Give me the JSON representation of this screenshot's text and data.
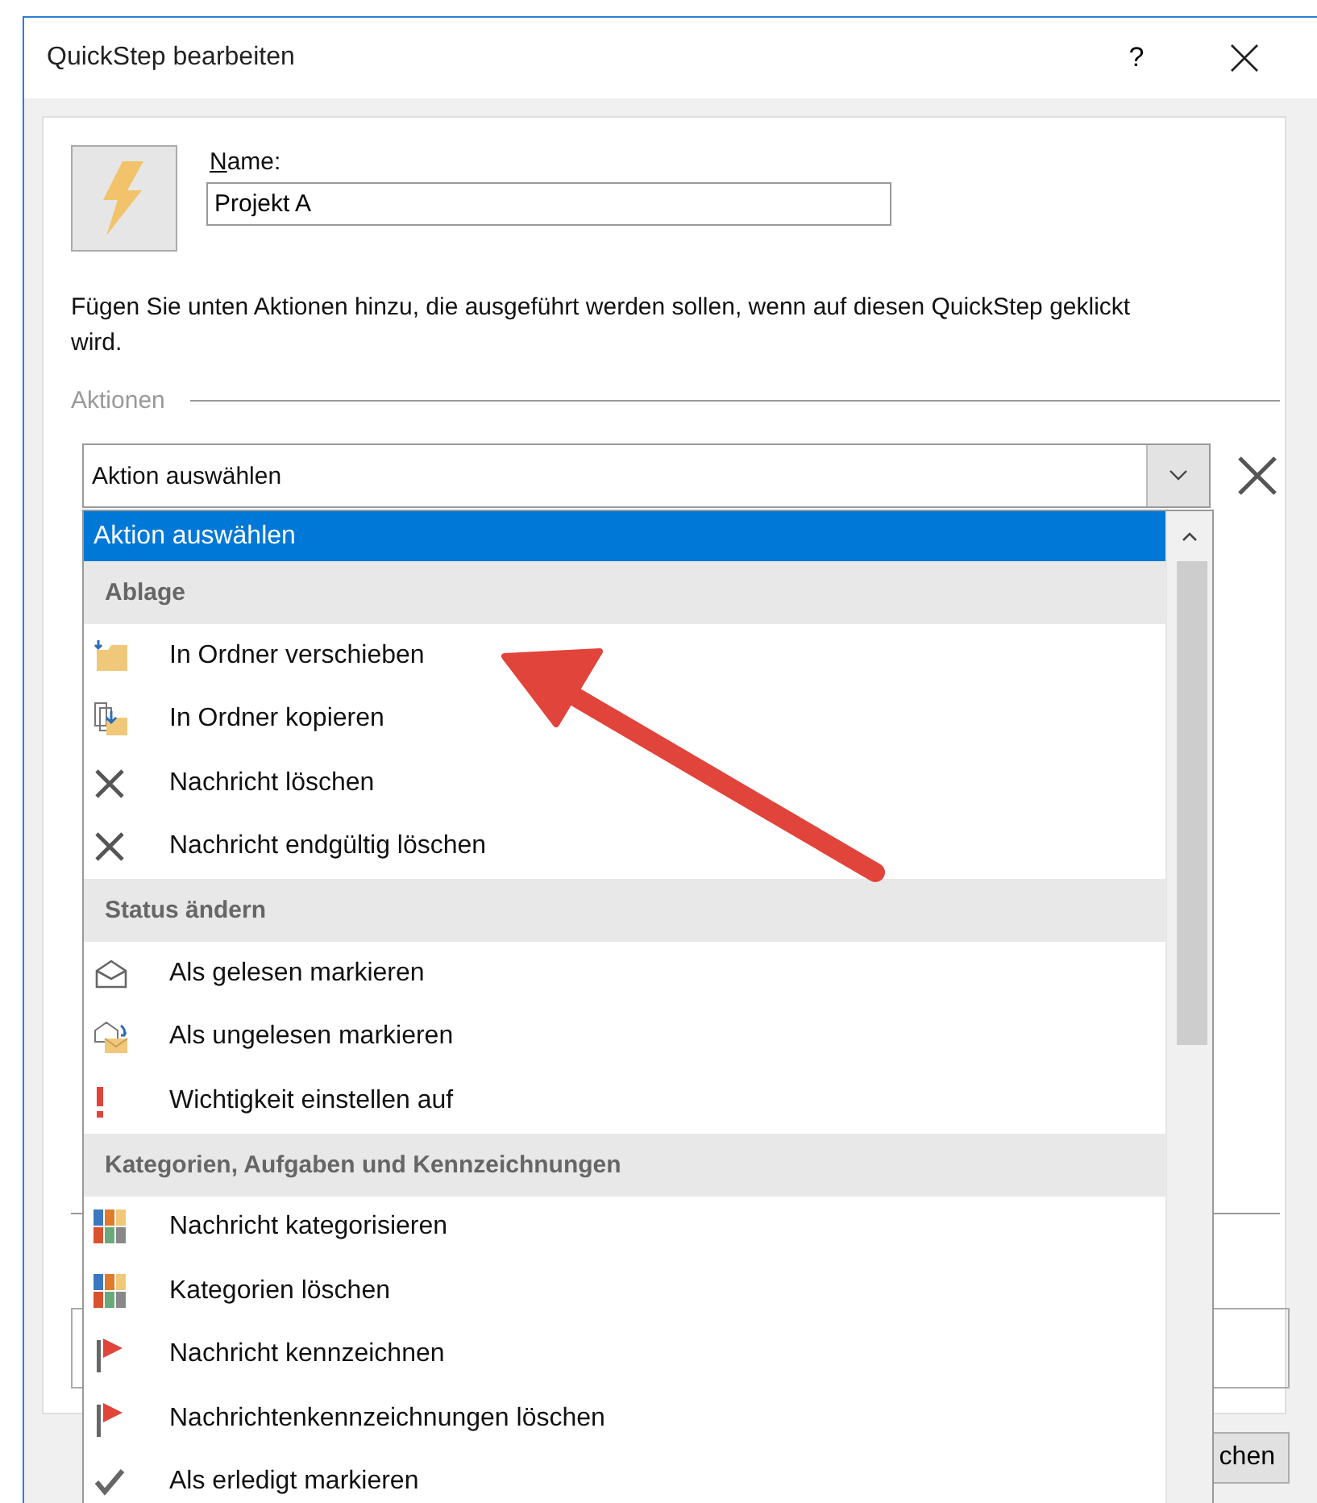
{
  "window": {
    "title": "QuickStep bearbeiten",
    "help": "?"
  },
  "name_label": "Name:",
  "name_value": "Projekt A",
  "description": "Fügen Sie unten Aktionen hinzu, die ausgeführt werden sollen, wenn auf diesen QuickStep geklickt wird.",
  "actions_label": "Aktionen",
  "combo": {
    "value": "Aktion auswählen",
    "expanded": true
  },
  "dropdown": [
    {
      "kind": "option",
      "label": "Aktion auswählen",
      "selected": true
    },
    {
      "kind": "header",
      "label": "Ablage"
    },
    {
      "kind": "move",
      "label": "In Ordner verschieben",
      "selected": false
    },
    {
      "kind": "copy",
      "label": "In Ordner kopieren",
      "selected": false
    },
    {
      "kind": "delete",
      "label": "Nachricht löschen",
      "selected": false
    },
    {
      "kind": "delete",
      "label": "Nachricht endgültig löschen",
      "selected": false
    },
    {
      "kind": "header",
      "label": "Status ändern"
    },
    {
      "kind": "read",
      "label": "Als gelesen markieren",
      "selected": false
    },
    {
      "kind": "unread",
      "label": "Als ungelesen markieren",
      "selected": false
    },
    {
      "kind": "importance",
      "label": "Wichtigkeit einstellen auf",
      "selected": false
    },
    {
      "kind": "header",
      "label": "Kategorien, Aufgaben und Kennzeichnungen"
    },
    {
      "kind": "categories",
      "label": "Nachricht kategorisieren",
      "selected": false
    },
    {
      "kind": "categories",
      "label": "Kategorien löschen",
      "selected": false
    },
    {
      "kind": "flag",
      "label": "Nachricht kennzeichnen",
      "selected": false
    },
    {
      "kind": "flag",
      "label": "Nachrichtenkennzeichnungen löschen",
      "selected": false
    },
    {
      "kind": "check",
      "label": "Als erledigt markieren",
      "selected": false
    }
  ],
  "bottom_button": "chen"
}
